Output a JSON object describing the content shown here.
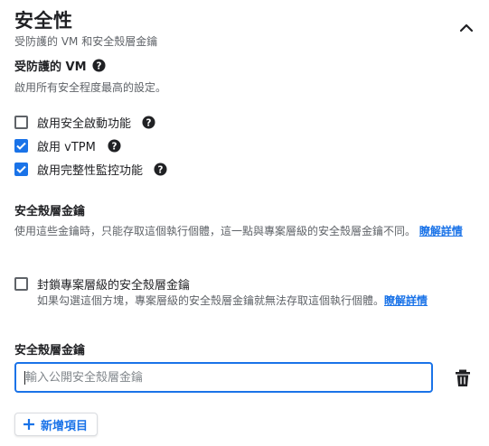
{
  "section": {
    "title": "安全性",
    "subtitle": "受防護的 VM 和安全殼層金鑰"
  },
  "shielded_vm": {
    "heading": "受防護的 VM",
    "description": "啟用所有安全程度最高的設定。",
    "options": [
      {
        "label": "啟用安全啟動功能",
        "checked": false
      },
      {
        "label": "啟用 vTPM",
        "checked": true
      },
      {
        "label": "啟用完整性監控功能",
        "checked": true
      }
    ]
  },
  "ssh_keys": {
    "heading": "安全殼層金鑰",
    "description_prefix": "使用這些金鑰時，只能存取這個執行個體，這一點與專案層級的安全殼層金鑰不同。",
    "description_link": "瞭解詳情",
    "block_label": "封鎖專案層級的安全殼層金鑰",
    "block_help": "如果勾選這個方塊，專案層級的安全殼層金鑰就無法存取這個執行個體。",
    "block_help_link": "瞭解詳情",
    "block_checked": false,
    "field_label": "安全殼層金鑰",
    "field_placeholder": "輸入公開安全殼層金鑰",
    "field_value": "",
    "add_button": "新增項目"
  },
  "colors": {
    "accent": "#1a73e8",
    "text": "#202124",
    "muted": "#5f6368"
  }
}
